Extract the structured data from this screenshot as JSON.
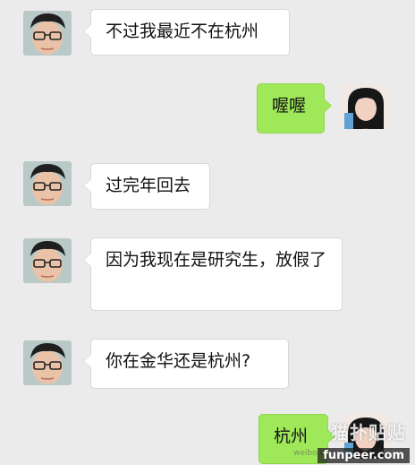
{
  "conversation": {
    "messages": [
      {
        "side": "in",
        "text": "不过我最近不在杭州"
      },
      {
        "side": "out",
        "text": "喔喔"
      },
      {
        "side": "in",
        "text": "过完年回去"
      },
      {
        "side": "in",
        "text": "因为我现在是研究生，放假了"
      },
      {
        "side": "in",
        "text": "你在金华还是杭州?"
      },
      {
        "side": "out",
        "text": "杭州"
      }
    ]
  },
  "watermark": {
    "logo": "猫扑贴贴",
    "site": "funpeer.com",
    "weibo": "weibo.com"
  },
  "colors": {
    "background": "#ebebeb",
    "incoming_bubble": "#ffffff",
    "outgoing_bubble": "#9fe85a"
  }
}
